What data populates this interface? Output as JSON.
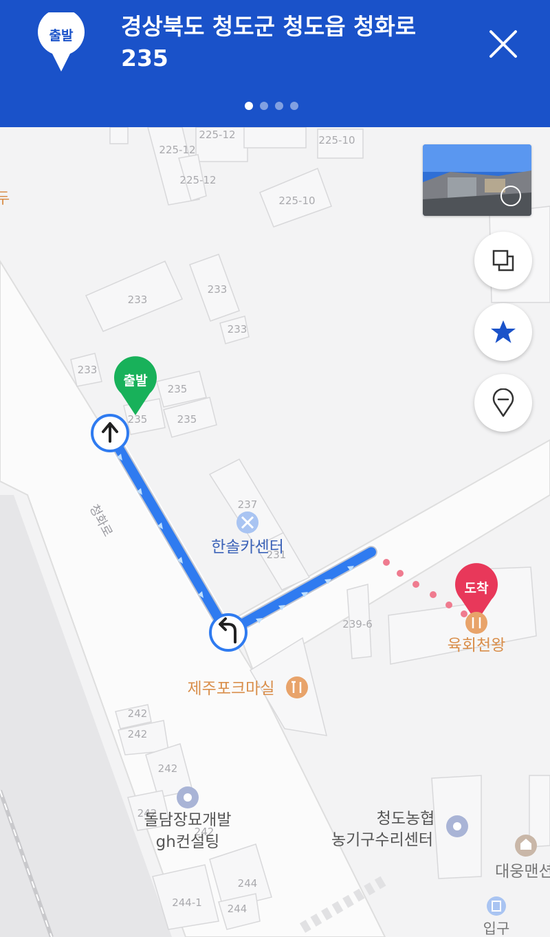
{
  "header": {
    "start_badge": "출발",
    "address": "경상북도 청도군 청도읍 청화로 235",
    "page_count": 4,
    "active_page": 1
  },
  "map": {
    "start_label": "출발",
    "end_label": "도착",
    "road_name": "청화로",
    "edge_label": "두",
    "lot_numbers": [
      "225-12",
      "225-10",
      "225-12",
      "225-12",
      "225-10",
      "233",
      "233",
      "233",
      "233",
      "235",
      "235",
      "235",
      "237",
      "231",
      "239-6",
      "242",
      "242",
      "242",
      "242",
      "242",
      "244",
      "244-1",
      "244"
    ],
    "pois": [
      {
        "name": "한솔카센터",
        "icon": "car-repair-icon"
      },
      {
        "name": "제주포크마실",
        "icon": "restaurant-icon"
      },
      {
        "name": "육회천왕",
        "icon": "restaurant-icon"
      },
      {
        "name": "돌담장묘개발",
        "icon": "place-icon"
      },
      {
        "name": "gh컨설팅",
        "icon": "none"
      },
      {
        "name": "청도농협",
        "icon": "place-icon"
      },
      {
        "name": "농기구수리센터",
        "icon": "none"
      },
      {
        "name": "대웅맨션",
        "icon": "building-icon"
      },
      {
        "name": "입구",
        "icon": "entrance-icon"
      }
    ],
    "turns": [
      "straight-arrow-icon",
      "left-turn-arrow-icon"
    ]
  },
  "controls": {
    "roadview_thumbnail": "street-view-thumbnail",
    "buttons": [
      "layers-icon",
      "star-icon",
      "location-pin-icon"
    ]
  },
  "colors": {
    "header": "#1a52c9",
    "route": "#2f7bf0",
    "start_pin": "#18b15a",
    "end_pin": "#e8385a",
    "poi_orange": "#d98e4a"
  }
}
